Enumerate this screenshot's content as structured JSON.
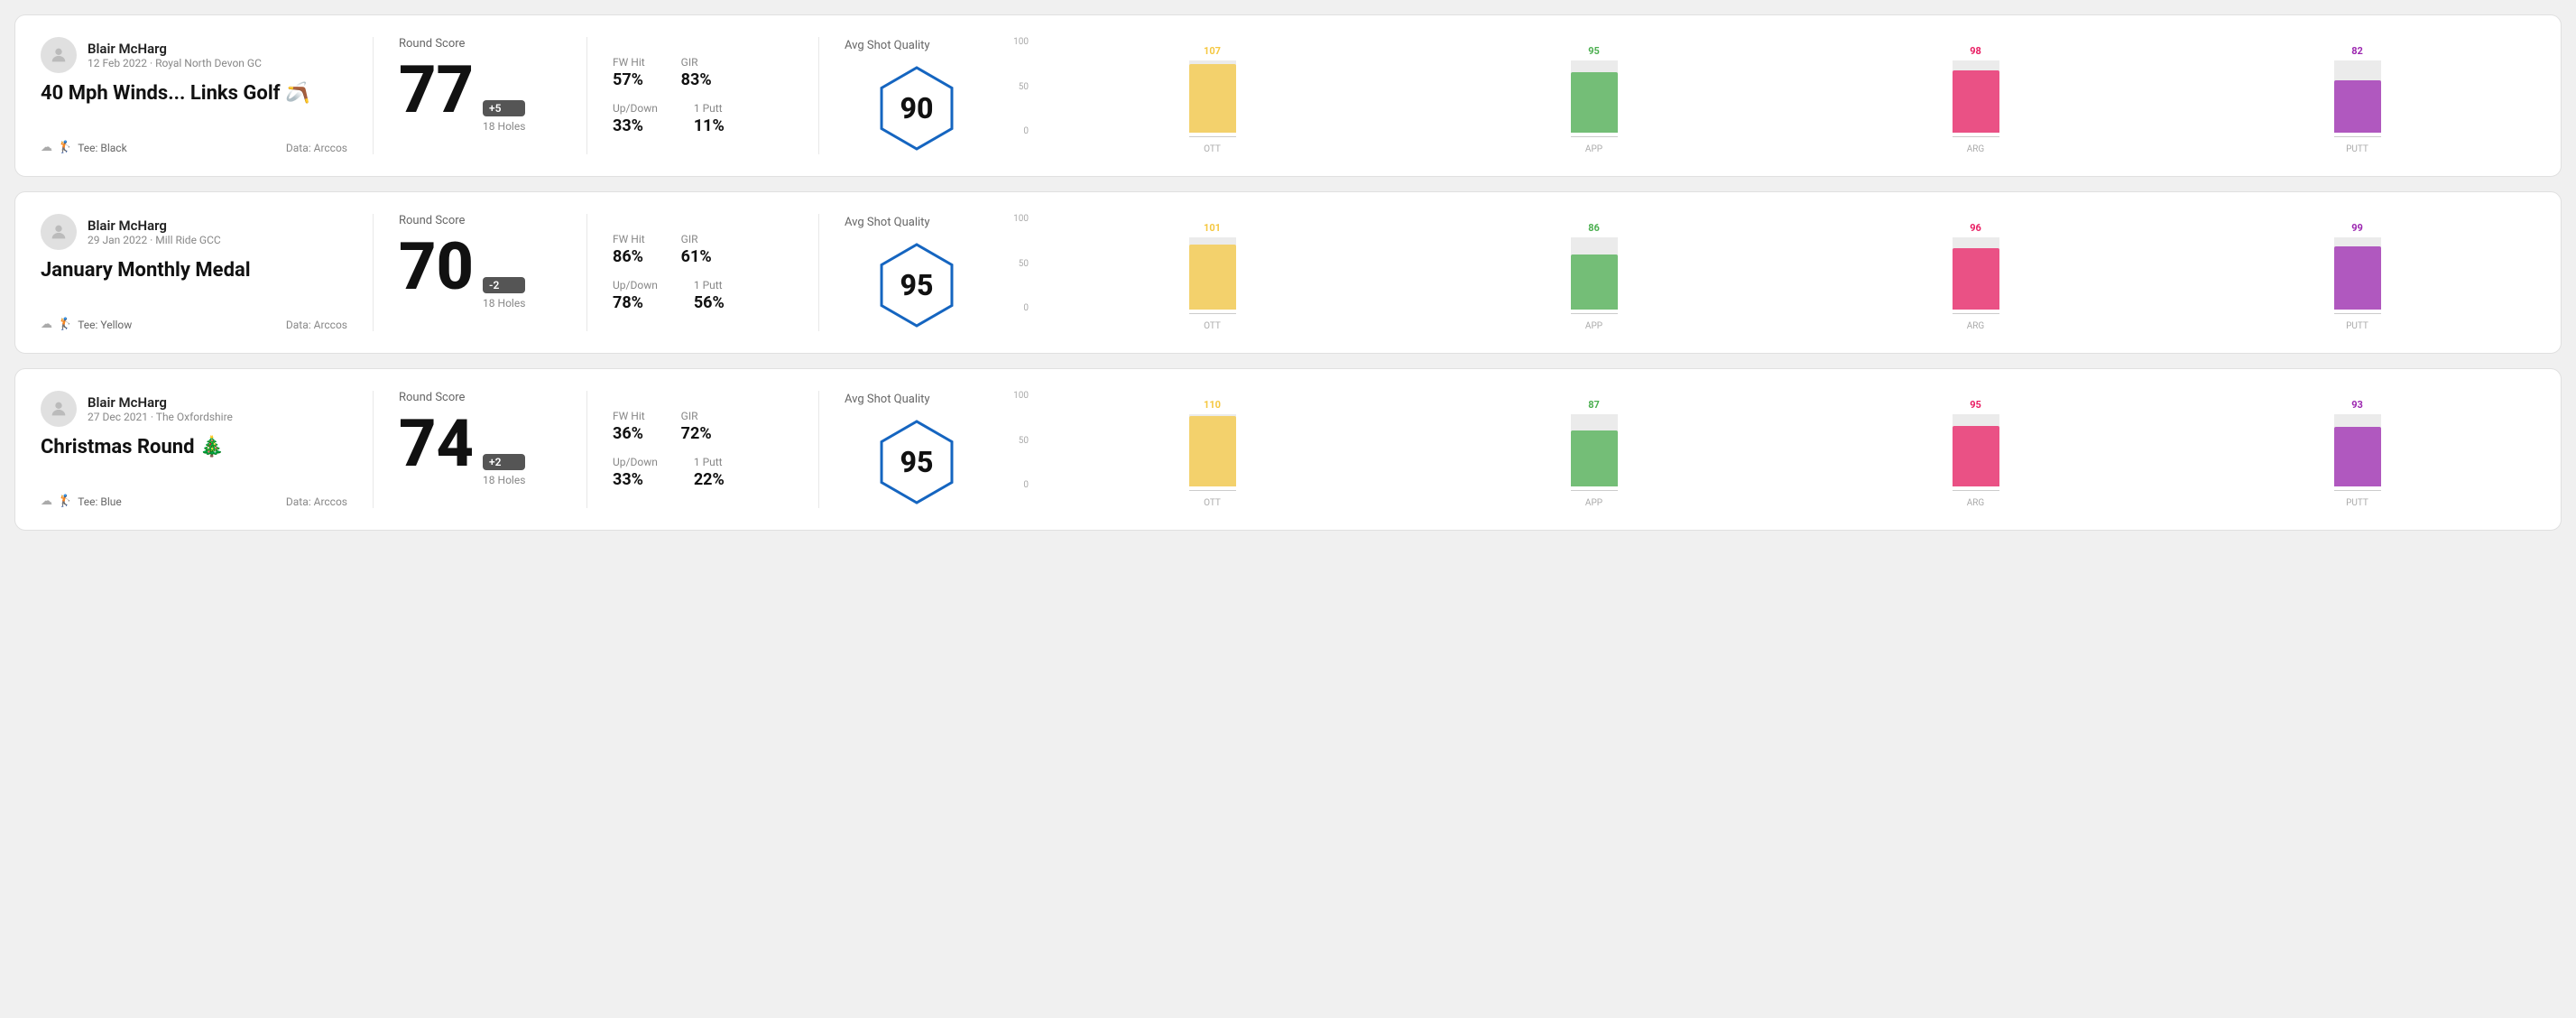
{
  "rounds": [
    {
      "id": "round-1",
      "user": {
        "name": "Blair McHarg",
        "date": "12 Feb 2022",
        "course": "Royal North Devon GC"
      },
      "title": "40 Mph Winds... Links Golf 🪃",
      "tee": "Black",
      "data_source": "Data: Arccos",
      "score": "77",
      "score_diff": "+5",
      "holes": "18 Holes",
      "stats": {
        "fw_hit_label": "FW Hit",
        "fw_hit_value": "57%",
        "gir_label": "GIR",
        "gir_value": "83%",
        "updown_label": "Up/Down",
        "updown_value": "33%",
        "putt_label": "1 Putt",
        "putt_value": "11%"
      },
      "avg_shot_quality_label": "Avg Shot Quality",
      "avg_shot_quality": "90",
      "chart": {
        "bars": [
          {
            "label": "OTT",
            "value": 107,
            "color": "#f5c842",
            "height_pct": 72
          },
          {
            "label": "APP",
            "value": 95,
            "color": "#4caf50",
            "height_pct": 64
          },
          {
            "label": "ARG",
            "value": 98,
            "color": "#e91e63",
            "height_pct": 66
          },
          {
            "label": "PUTT",
            "value": 82,
            "color": "#9c27b0",
            "height_pct": 55
          }
        ],
        "y_labels": [
          "100",
          "50",
          "0"
        ]
      }
    },
    {
      "id": "round-2",
      "user": {
        "name": "Blair McHarg",
        "date": "29 Jan 2022",
        "course": "Mill Ride GCC"
      },
      "title": "January Monthly Medal",
      "tee": "Yellow",
      "data_source": "Data: Arccos",
      "score": "70",
      "score_diff": "-2",
      "holes": "18 Holes",
      "stats": {
        "fw_hit_label": "FW Hit",
        "fw_hit_value": "86%",
        "gir_label": "GIR",
        "gir_value": "61%",
        "updown_label": "Up/Down",
        "updown_value": "78%",
        "putt_label": "1 Putt",
        "putt_value": "56%"
      },
      "avg_shot_quality_label": "Avg Shot Quality",
      "avg_shot_quality": "95",
      "chart": {
        "bars": [
          {
            "label": "OTT",
            "value": 101,
            "color": "#f5c842",
            "height_pct": 68
          },
          {
            "label": "APP",
            "value": 86,
            "color": "#4caf50",
            "height_pct": 58
          },
          {
            "label": "ARG",
            "value": 96,
            "color": "#e91e63",
            "height_pct": 65
          },
          {
            "label": "PUTT",
            "value": 99,
            "color": "#9c27b0",
            "height_pct": 67
          }
        ],
        "y_labels": [
          "100",
          "50",
          "0"
        ]
      }
    },
    {
      "id": "round-3",
      "user": {
        "name": "Blair McHarg",
        "date": "27 Dec 2021",
        "course": "The Oxfordshire"
      },
      "title": "Christmas Round 🎄",
      "tee": "Blue",
      "data_source": "Data: Arccos",
      "score": "74",
      "score_diff": "+2",
      "holes": "18 Holes",
      "stats": {
        "fw_hit_label": "FW Hit",
        "fw_hit_value": "36%",
        "gir_label": "GIR",
        "gir_value": "72%",
        "updown_label": "Up/Down",
        "updown_value": "33%",
        "putt_label": "1 Putt",
        "putt_value": "22%"
      },
      "avg_shot_quality_label": "Avg Shot Quality",
      "avg_shot_quality": "95",
      "chart": {
        "bars": [
          {
            "label": "OTT",
            "value": 110,
            "color": "#f5c842",
            "height_pct": 74
          },
          {
            "label": "APP",
            "value": 87,
            "color": "#4caf50",
            "height_pct": 58
          },
          {
            "label": "ARG",
            "value": 95,
            "color": "#e91e63",
            "height_pct": 64
          },
          {
            "label": "PUTT",
            "value": 93,
            "color": "#9c27b0",
            "height_pct": 63
          }
        ],
        "y_labels": [
          "100",
          "50",
          "0"
        ]
      }
    }
  ],
  "labels": {
    "round_score": "Round Score",
    "avg_shot_quality": "Avg Shot Quality",
    "tee_prefix": "Tee:",
    "data_arccos": "Data: Arccos"
  }
}
